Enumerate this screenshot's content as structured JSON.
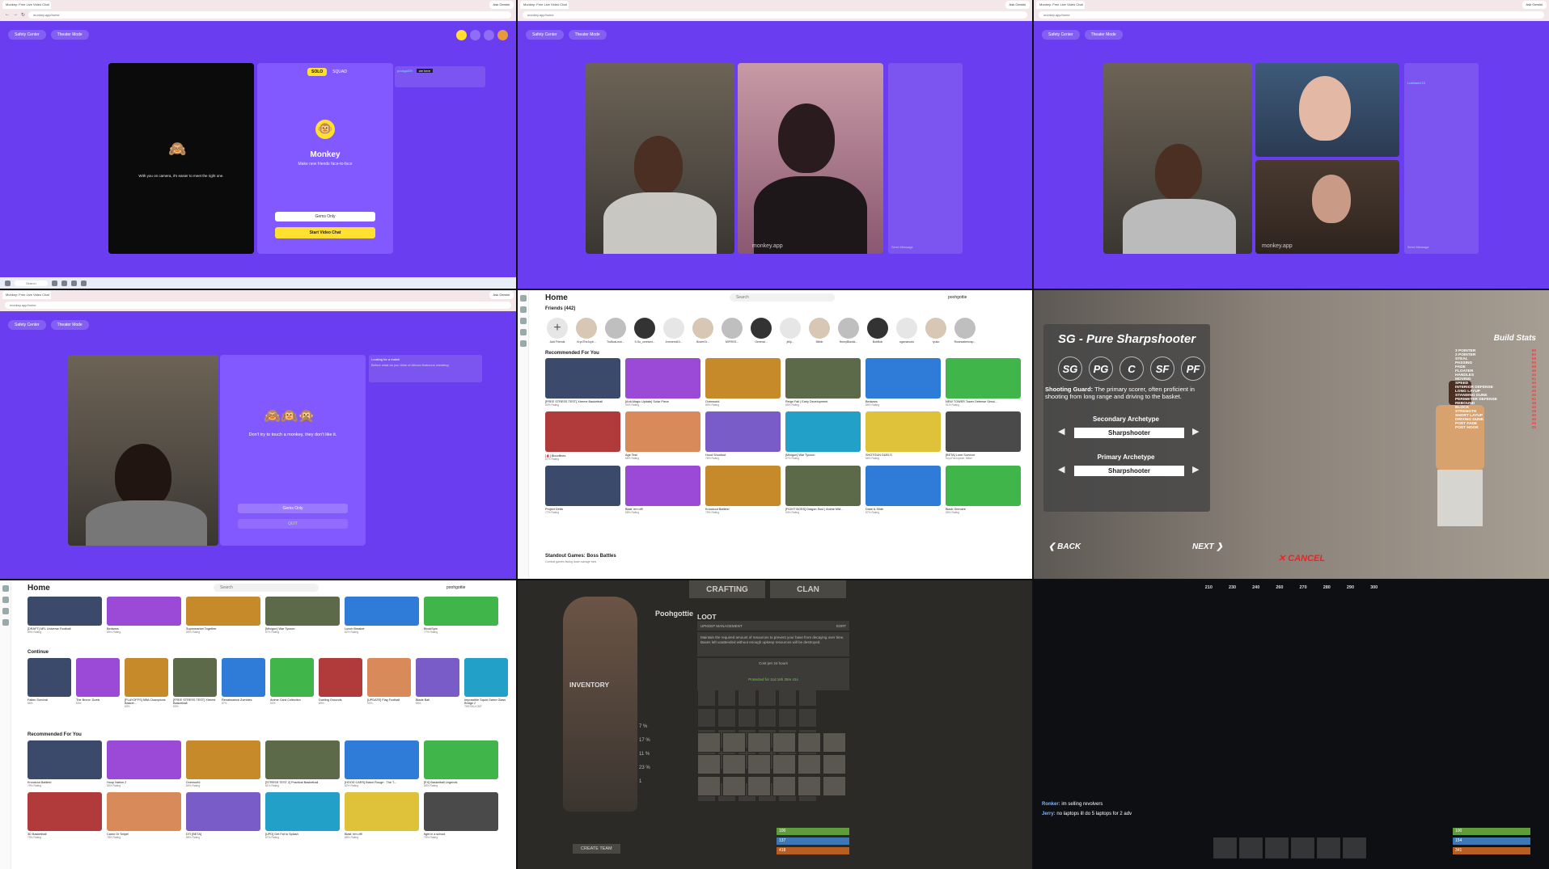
{
  "tile1": {
    "tab1": "Monkey: Free Live Video Chat",
    "gemini": "Ask Gemini",
    "url": "monkey.app/home",
    "safety": "Safety Center",
    "theater": "Theater Mode",
    "solo": "SOLO",
    "squad": "SQUAD",
    "chat_user": "pookgot29",
    "chat_msg": "we here",
    "cam_hint": "With you on camera, it's easier to meet the right one.",
    "app_name": "Monkey",
    "tagline": "Make new friends face-to-face",
    "gems": "Gems Only",
    "start": "Start Video Chat",
    "search": "Search"
  },
  "tile2": {
    "watermark": "monkey.app",
    "send": "Send Message"
  },
  "tile3": {
    "watermark": "monkey.app",
    "send": "Send Message",
    "side_user": "LukMark123"
  },
  "tile4": {
    "hint": "Don't try to touch a monkey, they don't like it.",
    "gems": "Gems Only",
    "quit": "QUIT",
    "sys_title": "Looking for a match",
    "sys_msg": "Before what do you think of African Baboons wrestling"
  },
  "tile5": {
    "title": "Home",
    "search": "Search",
    "user": "poohgottie",
    "friends": "Friends (442)",
    "add_friends": "Add Friends",
    "rec": "Recommended For You",
    "standout": "Standout Games: Boss Battles",
    "standout_sub": "Combat games facing down savage foes",
    "friend_names": [
      "KryoTheJoyb...",
      "TruBoaLeon...",
      "S.Su_ceresed...",
      "Jvmnerst19...",
      "BoxerGr...",
      "MIFRES...",
      "General...",
      "jelly...",
      "Mbbb",
      "HenryBlackk...",
      "BobBob",
      "ogsmanodo",
      "ryuko",
      "Rosewatersvsp..."
    ],
    "games": [
      {
        "name": "[FREE STRESS TEST] Xtreme Basketball",
        "rate": "83% Rating"
      },
      {
        "name": "[Anti-Magic Update] Solar Piece",
        "rate": "90% Rating"
      },
      {
        "name": "Overworld",
        "rate": "89% Rating"
      },
      {
        "name": "Reign Fall | Early Development",
        "rate": "85% Rating"
      },
      {
        "name": "Bedwars",
        "rate": "85% Rating"
      },
      {
        "name": "NEW TOWER Tower Defense Simul...",
        "rate": "91% Rating"
      },
      {
        "name": "[🩸] Bloodlines",
        "rate": "87% Rating"
      },
      {
        "name": "Age Test",
        "rate": "68% Rating"
      },
      {
        "name": "Hood Shootout",
        "rate": "76% Rating"
      },
      {
        "name": "[Minigun] War Tycoon",
        "rate": "87% Rating"
      },
      {
        "name": "SHOTGUN DUELS",
        "rate": "86% Rating"
      },
      {
        "name": "[BETA] Lone Survivor",
        "rate": "KryoTheJoymer, Miller"
      },
      {
        "name": "Project Delta",
        "rate": "77% Rating"
      },
      {
        "name": "Blast 'em off!",
        "rate": "88% Rating"
      },
      {
        "name": "Knockout Battles!",
        "rate": "79% Rating"
      },
      {
        "name": "[FIGHT BOSS] Dragon Soul | Anime MM...",
        "rate": "94% Rating"
      },
      {
        "name": "Draw & Slide",
        "rate": "87% Rating"
      },
      {
        "name": "Black Grimoire",
        "rate": "85% Rating"
      }
    ]
  },
  "tile6": {
    "title": "SG - Pure Sharpshooter",
    "positions": [
      "SG",
      "PG",
      "C",
      "SF",
      "PF"
    ],
    "desc_bold": "Shooting Guard:",
    "desc": "The primary scorer, often proficient in shooting from long range and driving to the basket.",
    "secondary": "Secondary Archetype",
    "secondary_val": "Sharpshooter",
    "primary": "Primary Archetype",
    "primary_val": "Sharpshooter",
    "back": "BACK",
    "next": "NEXT",
    "cancel": "CANCEL",
    "stats_title": "Build Stats",
    "stats": [
      {
        "k": "3 POINTER",
        "v": "99"
      },
      {
        "k": "2 POINTER",
        "v": "80"
      },
      {
        "k": "STEAL",
        "v": "58"
      },
      {
        "k": "PASSING",
        "v": "50"
      },
      {
        "k": "FADE",
        "v": "58"
      },
      {
        "k": "FLOATER",
        "v": "45"
      },
      {
        "k": "HANDLES",
        "v": "45"
      },
      {
        "k": "MOVING",
        "v": "51"
      },
      {
        "k": "SPEED",
        "v": "40"
      },
      {
        "k": "INTERIOR DEFENSE",
        "v": "45"
      },
      {
        "k": "LONG LAYUP",
        "v": "45"
      },
      {
        "k": "STANDING DUNK",
        "v": "45"
      },
      {
        "k": "PERIMETER DEFENSE",
        "v": "51"
      },
      {
        "k": "REBOUND",
        "v": "48"
      },
      {
        "k": "BLOCK",
        "v": "35"
      },
      {
        "k": "STRENGTH",
        "v": "28"
      },
      {
        "k": "SHORT LAYUP",
        "v": "40"
      },
      {
        "k": "DRIVING DUNK",
        "v": "40"
      },
      {
        "k": "POST FADE",
        "v": "25"
      },
      {
        "k": "POST HOOK",
        "v": "25"
      }
    ]
  },
  "tile7": {
    "title": "Home",
    "search": "Search",
    "user": "poohgottie",
    "continue": "Continue",
    "rec": "Recommended For You",
    "top": [
      {
        "name": "[DRAFT] NFL Universe Football",
        "rate": "89% Rating"
      },
      {
        "name": "Bedwars",
        "rate": "85% Rating"
      },
      {
        "name": "Supermarket Together",
        "rate": "89% Rating"
      },
      {
        "name": "[Minigun] War Tycoon",
        "rate": "87% Rating"
      },
      {
        "name": "Lunch Breaker",
        "rate": "82% Rating"
      },
      {
        "name": "BlockSpin",
        "rate": "77% Rating"
      }
    ],
    "cont": [
      {
        "name": "Fallen Survival",
        "rate": "86%"
      },
      {
        "name": "The Bronx: Duels",
        "rate": "84%"
      },
      {
        "name": "[PLAYOFFS] NBA Champions Basket...",
        "rate": "83%"
      },
      {
        "name": "[FREE STRESS TEST] Xtreme Basketball",
        "rate": "83%"
      },
      {
        "name": "Renaissance Zombies",
        "rate": "87%"
      },
      {
        "name": "Anime Card Collection",
        "rate": "92%"
      },
      {
        "name": "Dueling Grounds",
        "rate": "89%"
      },
      {
        "name": "[UPDATE] Flag Football",
        "rate": "92%"
      },
      {
        "name": "Blade Ball",
        "rate": "86%"
      },
      {
        "name": "Impossible Squid Game Glass Bridge 2",
        "rate": "THEITALICBIT"
      }
    ],
    "rec_games": [
      {
        "name": "Knockout Battles!",
        "rate": "79% Rating"
      },
      {
        "name": "Hoop Nation 2",
        "rate": "80% Rating"
      },
      {
        "name": "Overworld",
        "rate": "89% Rating"
      },
      {
        "name": "[STRESS TEST 2] Practical Basketball",
        "rate": "81% Rating"
      },
      {
        "name": "[HOOD CARS] Baton Rouge : The T...",
        "rate": "82% Rating"
      },
      {
        "name": "[EX] Basketball Legends",
        "rate": "88% Rating"
      },
      {
        "name": "3D Basketball",
        "rate": "79% Rating"
      },
      {
        "name": "Camo Or Snipe!",
        "rate": "78% Rating"
      },
      {
        "name": "DTI [BETA]",
        "rate": "86% Rating"
      },
      {
        "name": "[UPD] Get Fat to Splash",
        "rate": "87% Rating"
      },
      {
        "name": "Blast 'em off!",
        "rate": "88% Rating"
      },
      {
        "name": "fight in a school",
        "rate": "75% Rating"
      }
    ]
  },
  "tile8": {
    "crafting": "CRAFTING",
    "clan": "CLAN",
    "name": "Poohgottie",
    "loot": "LOOT",
    "upkeep": "UPKEEP MANAGEMENT",
    "sort": "SORT",
    "upkeep_desc": "Maintain the required amount of resources to prevent your base from decaying over time. Bases left unattended without enough upkeep resources will be destroyed.",
    "cost": "Cost per 24 hours",
    "protected": "Protected for 11d 16h 25m 41s",
    "inventory": "INVENTORY",
    "create_team": "CREATE TEAM",
    "stats": [
      "7 %",
      "17 %",
      "11 %",
      "23 %",
      "1"
    ],
    "health": "100",
    "water": "137",
    "food": "418"
  },
  "tile9": {
    "compass": [
      "210",
      "230",
      "240",
      "260",
      "270",
      "280",
      "290",
      "300"
    ],
    "chat": [
      {
        "user": "Ronker:",
        "msg": "im selling revolvers"
      },
      {
        "user": "Jerry:",
        "msg": "no laptops ill do 5 laptops for 2 adv"
      }
    ],
    "health": "100",
    "water": "154",
    "food": "341"
  }
}
